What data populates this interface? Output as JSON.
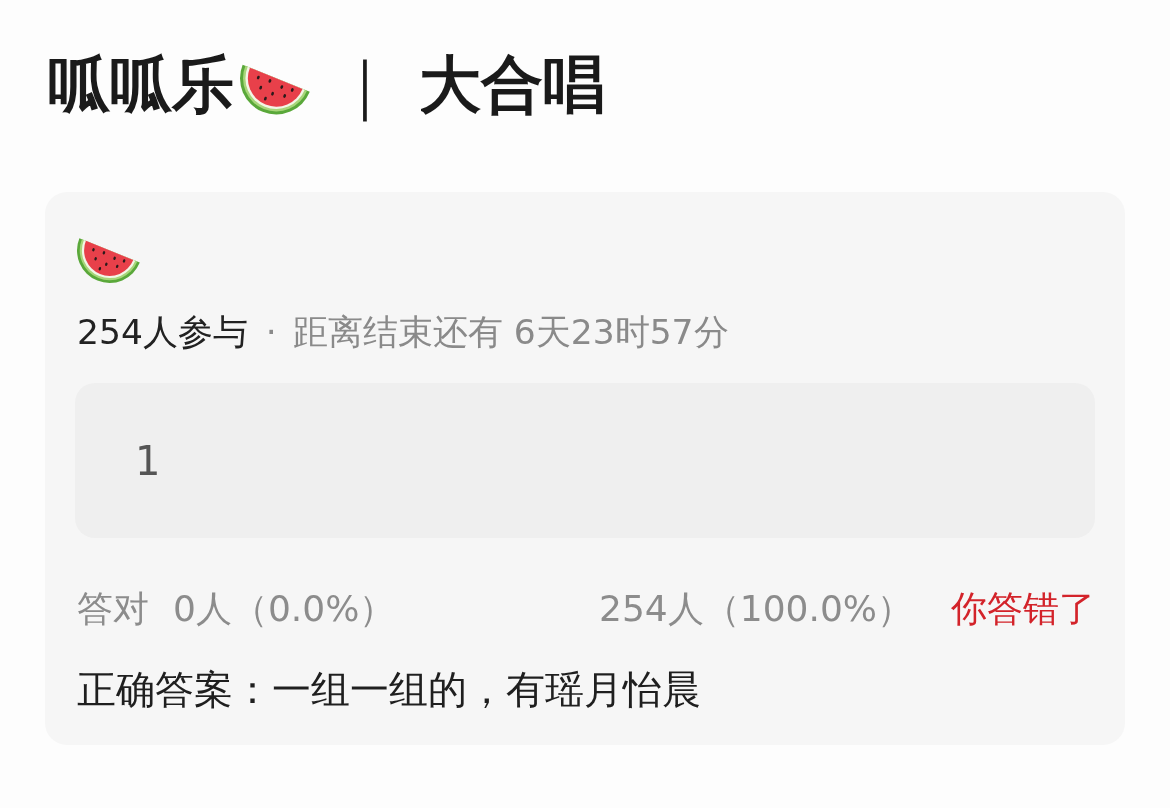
{
  "title": {
    "name": "呱呱乐",
    "separator": "｜",
    "subtitle": "大合唱"
  },
  "quiz": {
    "participants": "254人参与",
    "dot": "·",
    "countdown": "距离结束还有 6天23时57分",
    "answer": "1",
    "stats": {
      "correct_label": "答对",
      "correct_count": "0人（0.0%）",
      "wrong_count": "254人（100.0%）"
    },
    "result": {
      "text": "你答错了",
      "correct": false
    },
    "correct_answer": "正确答案：一组一组的，有瑶月怡晨"
  }
}
